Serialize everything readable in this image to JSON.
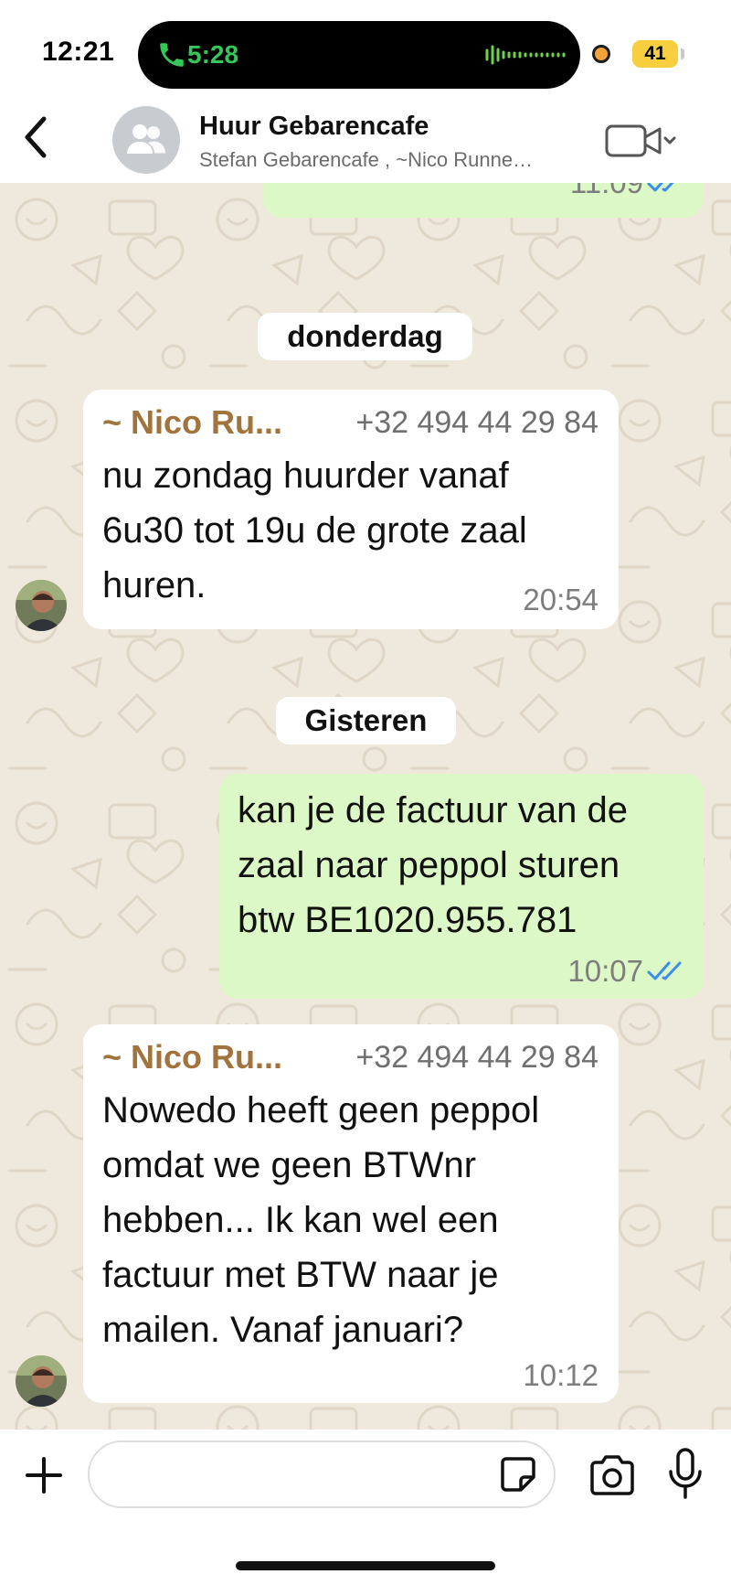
{
  "status_bar": {
    "time": "12:21",
    "call_duration": "5:28",
    "battery": "41",
    "accent_call_color": "#34c759",
    "battery_color": "#f7cf3e"
  },
  "header": {
    "title": "Huur Gebarencafe",
    "subtitle": "Stefan Gebarencafe , ~Nico Runne…",
    "icons": [
      "chevron-left-icon",
      "group-icon",
      "video-camera-icon",
      "chevron-down-icon"
    ]
  },
  "messages": [
    {
      "direction": "out",
      "time": "11:09",
      "read": true
    },
    {
      "type": "date",
      "label": "donderdag"
    },
    {
      "direction": "in",
      "sender": "~ Nico Ru...",
      "phone": "+32 494 44 29 84",
      "lines": [
        "nu zondag huurder vanaf",
        "6u30 tot 19u de grote zaal",
        "huren."
      ],
      "time": "20:54"
    },
    {
      "type": "date",
      "label": "Gisteren"
    },
    {
      "direction": "out",
      "lines": [
        "kan je de factuur van de",
        "zaal naar peppol sturen",
        "btw BE1020.955.781"
      ],
      "time": "10:07",
      "read": true
    },
    {
      "direction": "in",
      "sender": "~ Nico Ru...",
      "phone": "+32 494 44 29 84",
      "lines": [
        "Nowedo heeft geen peppol",
        "omdat we geen BTWnr",
        "hebben... Ik kan wel een",
        "factuur met BTW naar je",
        "mailen. Vanaf januari?"
      ],
      "time": "10:12"
    }
  ],
  "composer": {
    "input_value": "",
    "icons": [
      "plus-icon",
      "sticker-icon",
      "camera-icon",
      "microphone-icon"
    ]
  },
  "colors": {
    "outgoing_bubble": "#dcf8c6",
    "incoming_bubble": "#ffffff",
    "sender_name": "#a0743c",
    "read_ticks": "#3b8ef0",
    "wallpaper": "#efe8dc"
  }
}
